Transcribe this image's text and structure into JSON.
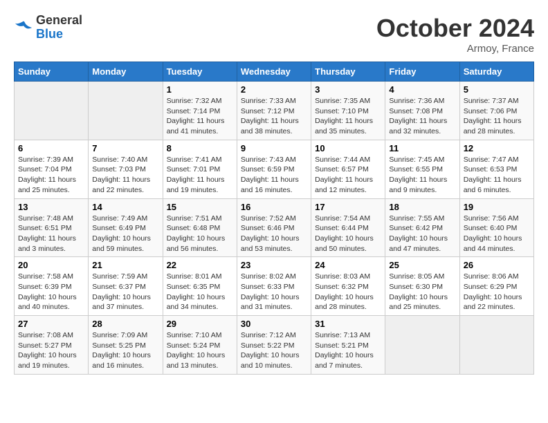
{
  "header": {
    "logo_general": "General",
    "logo_blue": "Blue",
    "month_title": "October 2024",
    "location": "Armoy, France"
  },
  "weekdays": [
    "Sunday",
    "Monday",
    "Tuesday",
    "Wednesday",
    "Thursday",
    "Friday",
    "Saturday"
  ],
  "weeks": [
    [
      {
        "day": "",
        "empty": true
      },
      {
        "day": "",
        "empty": true
      },
      {
        "day": "1",
        "sunrise": "Sunrise: 7:32 AM",
        "sunset": "Sunset: 7:14 PM",
        "daylight": "Daylight: 11 hours and 41 minutes."
      },
      {
        "day": "2",
        "sunrise": "Sunrise: 7:33 AM",
        "sunset": "Sunset: 7:12 PM",
        "daylight": "Daylight: 11 hours and 38 minutes."
      },
      {
        "day": "3",
        "sunrise": "Sunrise: 7:35 AM",
        "sunset": "Sunset: 7:10 PM",
        "daylight": "Daylight: 11 hours and 35 minutes."
      },
      {
        "day": "4",
        "sunrise": "Sunrise: 7:36 AM",
        "sunset": "Sunset: 7:08 PM",
        "daylight": "Daylight: 11 hours and 32 minutes."
      },
      {
        "day": "5",
        "sunrise": "Sunrise: 7:37 AM",
        "sunset": "Sunset: 7:06 PM",
        "daylight": "Daylight: 11 hours and 28 minutes."
      }
    ],
    [
      {
        "day": "6",
        "sunrise": "Sunrise: 7:39 AM",
        "sunset": "Sunset: 7:04 PM",
        "daylight": "Daylight: 11 hours and 25 minutes."
      },
      {
        "day": "7",
        "sunrise": "Sunrise: 7:40 AM",
        "sunset": "Sunset: 7:03 PM",
        "daylight": "Daylight: 11 hours and 22 minutes."
      },
      {
        "day": "8",
        "sunrise": "Sunrise: 7:41 AM",
        "sunset": "Sunset: 7:01 PM",
        "daylight": "Daylight: 11 hours and 19 minutes."
      },
      {
        "day": "9",
        "sunrise": "Sunrise: 7:43 AM",
        "sunset": "Sunset: 6:59 PM",
        "daylight": "Daylight: 11 hours and 16 minutes."
      },
      {
        "day": "10",
        "sunrise": "Sunrise: 7:44 AM",
        "sunset": "Sunset: 6:57 PM",
        "daylight": "Daylight: 11 hours and 12 minutes."
      },
      {
        "day": "11",
        "sunrise": "Sunrise: 7:45 AM",
        "sunset": "Sunset: 6:55 PM",
        "daylight": "Daylight: 11 hours and 9 minutes."
      },
      {
        "day": "12",
        "sunrise": "Sunrise: 7:47 AM",
        "sunset": "Sunset: 6:53 PM",
        "daylight": "Daylight: 11 hours and 6 minutes."
      }
    ],
    [
      {
        "day": "13",
        "sunrise": "Sunrise: 7:48 AM",
        "sunset": "Sunset: 6:51 PM",
        "daylight": "Daylight: 11 hours and 3 minutes."
      },
      {
        "day": "14",
        "sunrise": "Sunrise: 7:49 AM",
        "sunset": "Sunset: 6:49 PM",
        "daylight": "Daylight: 10 hours and 59 minutes."
      },
      {
        "day": "15",
        "sunrise": "Sunrise: 7:51 AM",
        "sunset": "Sunset: 6:48 PM",
        "daylight": "Daylight: 10 hours and 56 minutes."
      },
      {
        "day": "16",
        "sunrise": "Sunrise: 7:52 AM",
        "sunset": "Sunset: 6:46 PM",
        "daylight": "Daylight: 10 hours and 53 minutes."
      },
      {
        "day": "17",
        "sunrise": "Sunrise: 7:54 AM",
        "sunset": "Sunset: 6:44 PM",
        "daylight": "Daylight: 10 hours and 50 minutes."
      },
      {
        "day": "18",
        "sunrise": "Sunrise: 7:55 AM",
        "sunset": "Sunset: 6:42 PM",
        "daylight": "Daylight: 10 hours and 47 minutes."
      },
      {
        "day": "19",
        "sunrise": "Sunrise: 7:56 AM",
        "sunset": "Sunset: 6:40 PM",
        "daylight": "Daylight: 10 hours and 44 minutes."
      }
    ],
    [
      {
        "day": "20",
        "sunrise": "Sunrise: 7:58 AM",
        "sunset": "Sunset: 6:39 PM",
        "daylight": "Daylight: 10 hours and 40 minutes."
      },
      {
        "day": "21",
        "sunrise": "Sunrise: 7:59 AM",
        "sunset": "Sunset: 6:37 PM",
        "daylight": "Daylight: 10 hours and 37 minutes."
      },
      {
        "day": "22",
        "sunrise": "Sunrise: 8:01 AM",
        "sunset": "Sunset: 6:35 PM",
        "daylight": "Daylight: 10 hours and 34 minutes."
      },
      {
        "day": "23",
        "sunrise": "Sunrise: 8:02 AM",
        "sunset": "Sunset: 6:33 PM",
        "daylight": "Daylight: 10 hours and 31 minutes."
      },
      {
        "day": "24",
        "sunrise": "Sunrise: 8:03 AM",
        "sunset": "Sunset: 6:32 PM",
        "daylight": "Daylight: 10 hours and 28 minutes."
      },
      {
        "day": "25",
        "sunrise": "Sunrise: 8:05 AM",
        "sunset": "Sunset: 6:30 PM",
        "daylight": "Daylight: 10 hours and 25 minutes."
      },
      {
        "day": "26",
        "sunrise": "Sunrise: 8:06 AM",
        "sunset": "Sunset: 6:29 PM",
        "daylight": "Daylight: 10 hours and 22 minutes."
      }
    ],
    [
      {
        "day": "27",
        "sunrise": "Sunrise: 7:08 AM",
        "sunset": "Sunset: 5:27 PM",
        "daylight": "Daylight: 10 hours and 19 minutes."
      },
      {
        "day": "28",
        "sunrise": "Sunrise: 7:09 AM",
        "sunset": "Sunset: 5:25 PM",
        "daylight": "Daylight: 10 hours and 16 minutes."
      },
      {
        "day": "29",
        "sunrise": "Sunrise: 7:10 AM",
        "sunset": "Sunset: 5:24 PM",
        "daylight": "Daylight: 10 hours and 13 minutes."
      },
      {
        "day": "30",
        "sunrise": "Sunrise: 7:12 AM",
        "sunset": "Sunset: 5:22 PM",
        "daylight": "Daylight: 10 hours and 10 minutes."
      },
      {
        "day": "31",
        "sunrise": "Sunrise: 7:13 AM",
        "sunset": "Sunset: 5:21 PM",
        "daylight": "Daylight: 10 hours and 7 minutes."
      },
      {
        "day": "",
        "empty": true
      },
      {
        "day": "",
        "empty": true
      }
    ]
  ]
}
